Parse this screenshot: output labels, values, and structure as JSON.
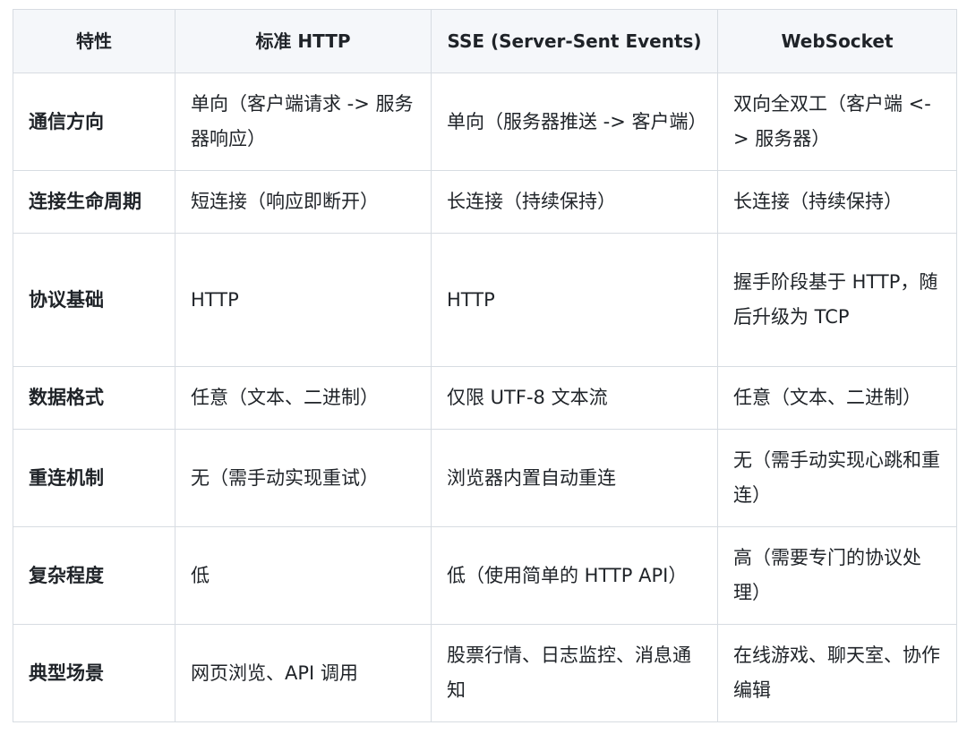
{
  "table": {
    "headers": [
      "特性",
      "标准 HTTP",
      "SSE (Server-Sent Events)",
      "WebSocket"
    ],
    "rows": [
      [
        "通信方向",
        "单向（客户端请求 -> 服务器响应）",
        "单向（服务器推送 -> 客户端）",
        "双向全双工（客户端 <-> 服务器）"
      ],
      [
        "连接生命周期",
        "短连接（响应即断开）",
        "长连接（持续保持）",
        "长连接（持续保持）"
      ],
      [
        "协议基础",
        "HTTP",
        "HTTP",
        "握手阶段基于 HTTP，随后升级为 TCP"
      ],
      [
        "数据格式",
        "任意（文本、二进制）",
        "仅限 UTF-8 文本流",
        "任意（文本、二进制）"
      ],
      [
        "重连机制",
        "无（需手动实现重试）",
        "浏览器内置自动重连",
        "无（需手动实现心跳和重连）"
      ],
      [
        "复杂程度",
        "低",
        "低（使用简单的 HTTP API）",
        "高（需要专门的协议处理）"
      ],
      [
        "典型场景",
        "网页浏览、API 调用",
        "股票行情、日志监控、消息通知",
        "在线游戏、聊天室、协作编辑"
      ]
    ]
  }
}
